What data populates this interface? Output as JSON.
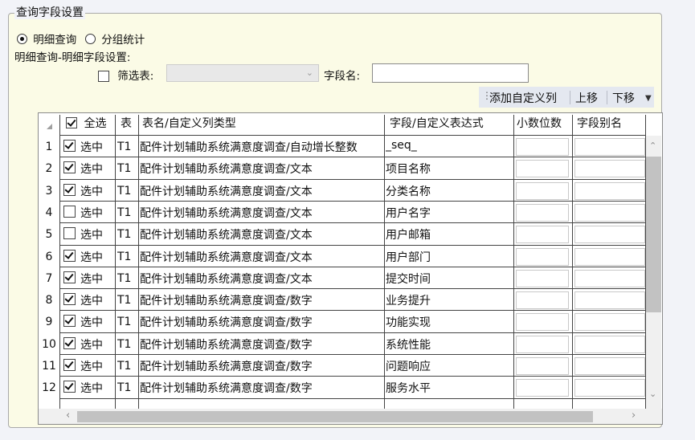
{
  "group_title": "查询字段设置",
  "mode": {
    "detail_label": "明细查询",
    "group_label": "分组统计",
    "selected": "detail"
  },
  "section_label": "明细查询-明细字段设置:",
  "filter": {
    "checkbox_label": "筛选表:",
    "checked": false,
    "combo_value": ""
  },
  "field_name": {
    "label": "字段名:",
    "value": ""
  },
  "toolbar": {
    "add_label": "添加自定义列",
    "up_label": "上移",
    "down_label": "下移"
  },
  "table": {
    "select_all_label": "全选",
    "select_all_checked": true,
    "columns": [
      "表",
      "表名/自定义列类型",
      "字段/自定义表达式",
      "小数位数",
      "字段别名"
    ],
    "check_label": "选中",
    "rows": [
      {
        "num": "1",
        "checked": true,
        "table": "T1",
        "type": "配件计划辅助系统满意度调查/自动增长整数",
        "field": "_seq_"
      },
      {
        "num": "2",
        "checked": true,
        "table": "T1",
        "type": "配件计划辅助系统满意度调查/文本",
        "field": "项目名称"
      },
      {
        "num": "3",
        "checked": true,
        "table": "T1",
        "type": "配件计划辅助系统满意度调查/文本",
        "field": "分类名称"
      },
      {
        "num": "4",
        "checked": false,
        "table": "T1",
        "type": "配件计划辅助系统满意度调查/文本",
        "field": "用户名字"
      },
      {
        "num": "5",
        "checked": false,
        "table": "T1",
        "type": "配件计划辅助系统满意度调查/文本",
        "field": "用户邮箱"
      },
      {
        "num": "6",
        "checked": true,
        "table": "T1",
        "type": "配件计划辅助系统满意度调查/文本",
        "field": "用户部门"
      },
      {
        "num": "7",
        "checked": true,
        "table": "T1",
        "type": "配件计划辅助系统满意度调查/文本",
        "field": "提交时间"
      },
      {
        "num": "8",
        "checked": true,
        "table": "T1",
        "type": "配件计划辅助系统满意度调查/数字",
        "field": "业务提升"
      },
      {
        "num": "9",
        "checked": true,
        "table": "T1",
        "type": "配件计划辅助系统满意度调查/数字",
        "field": "功能实现"
      },
      {
        "num": "10",
        "checked": true,
        "table": "T1",
        "type": "配件计划辅助系统满意度调查/数字",
        "field": "系统性能"
      },
      {
        "num": "11",
        "checked": true,
        "table": "T1",
        "type": "配件计划辅助系统满意度调查/数字",
        "field": "问题响应"
      },
      {
        "num": "12",
        "checked": true,
        "table": "T1",
        "type": "配件计划辅助系统满意度调查/数字",
        "field": "服务水平"
      }
    ]
  }
}
